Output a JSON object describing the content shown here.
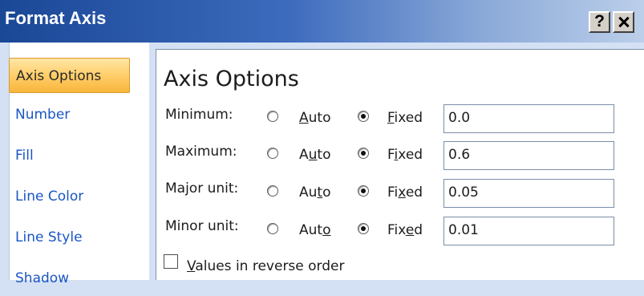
{
  "window": {
    "title": "Format Axis",
    "help_label": "?"
  },
  "sidebar": {
    "items": [
      {
        "label": "Axis Options",
        "selected": true
      },
      {
        "label": "Number",
        "selected": false
      },
      {
        "label": "Fill",
        "selected": false
      },
      {
        "label": "Line Color",
        "selected": false
      },
      {
        "label": "Line Style",
        "selected": false
      },
      {
        "label": "Shadow",
        "selected": false
      }
    ]
  },
  "panel": {
    "title": "Axis Options",
    "rows": [
      {
        "label": "Minimum:",
        "auto_pre": "",
        "auto_key": "A",
        "auto_post": "uto",
        "fixed_pre": "",
        "fixed_key": "F",
        "fixed_post": "ixed",
        "selected": "fixed",
        "value": "0.0"
      },
      {
        "label": "Maximum:",
        "auto_pre": "A",
        "auto_key": "u",
        "auto_post": "to",
        "fixed_pre": "F",
        "fixed_key": "i",
        "fixed_post": "xed",
        "selected": "fixed",
        "value": "0.6"
      },
      {
        "label": "Major unit:",
        "auto_pre": "Au",
        "auto_key": "t",
        "auto_post": "o",
        "fixed_pre": "Fi",
        "fixed_key": "x",
        "fixed_post": "ed",
        "selected": "fixed",
        "value": "0.05"
      },
      {
        "label": "Minor unit:",
        "auto_pre": "Aut",
        "auto_key": "o",
        "auto_post": "",
        "fixed_pre": "Fix",
        "fixed_key": "e",
        "fixed_post": "d",
        "selected": "fixed",
        "value": "0.01"
      }
    ],
    "reverse_order": {
      "key": "V",
      "rest": "alues in reverse order",
      "checked": false
    }
  }
}
